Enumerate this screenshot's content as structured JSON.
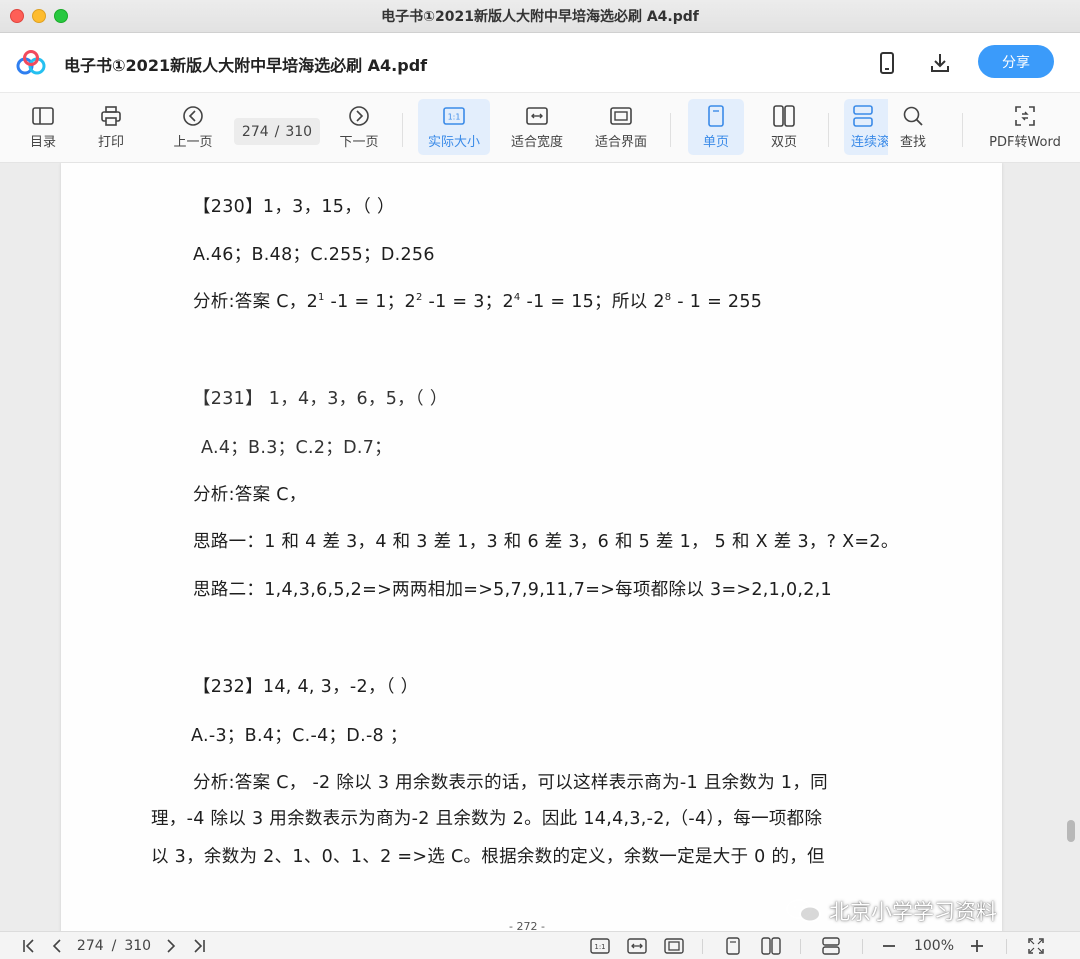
{
  "window": {
    "title": "电子书①2021新版人大附中早培海选必刷  A4.pdf"
  },
  "header": {
    "doc_title": "电子书①2021新版人大附中早培海选必刷 A4.pdf",
    "share_label": "分享"
  },
  "toolbar": {
    "toc": "目录",
    "print": "打印",
    "prev": "上一页",
    "current_page": "274",
    "sep": "/",
    "total_pages": "310",
    "next": "下一页",
    "actual_size": "实际大小",
    "fit_width": "适合宽度",
    "fit_window": "适合界面",
    "single_page": "单页",
    "double_page": "双页",
    "continuous": "连续滚",
    "find": "查找",
    "pdf_to_word": "PDF转Word"
  },
  "content": {
    "q230_title": "【230】1，3，15，（ ）",
    "q230_options": "A.46；B.48；C.255；D.256",
    "q230_analysis_a": "分析:答案 C，2",
    "q230_sup1": "1",
    "q230_analysis_b": " -1 = 1；2",
    "q230_sup2": "2",
    "q230_analysis_c": " -1 = 3；2",
    "q230_sup3": "4",
    "q230_analysis_d": " -1 = 15；所以  2",
    "q230_sup4": "8",
    "q230_analysis_e": " - 1 = 255",
    "q231_title": "【231】  1，4，3，6，5，（ ）",
    "q231_options": "A.4；B.3；C.2；D.7；",
    "q231_analysis": "分析:答案 C，",
    "q231_idea1": "思路一：1 和 4 差 3，4 和 3 差 1，3 和 6 差 3，6 和 5 差 1，  5 和 X 差 3，? X=2。",
    "q231_idea2": "思路二：1,4,3,6,5,2=>两两相加=>5,7,9,11,7=>每项都除以 3=>2,1,0,2,1",
    "q232_title": "【232】14, 4, 3，-2，（ ）",
    "q232_options": "A.-3；B.4；C.-4；D.-8 ；",
    "q232_analysis_1": "分析:答案 C，  -2 除以 3 用余数表示的话，可以这样表示商为-1 且余数为 1，同",
    "q232_analysis_2": "理，-4 除以 3 用余数表示为商为-2 且余数为 2。因此 14,4,3,-2,（-4），每一项都除",
    "q232_analysis_3": "以 3，余数为 2、1、0、1、2    =>选 C。根据余数的定义，余数一定是大于 0 的，但",
    "page_footer": "- 272 -"
  },
  "watermark": {
    "text": "北京小学学习资料"
  },
  "bottombar": {
    "current_page": "274",
    "sep": "/",
    "total_pages": "310",
    "zoom": "100%"
  },
  "colors": {
    "accent": "#3b9bfa",
    "active_bg": "#e3eefc",
    "active_text": "#3b8be8"
  }
}
